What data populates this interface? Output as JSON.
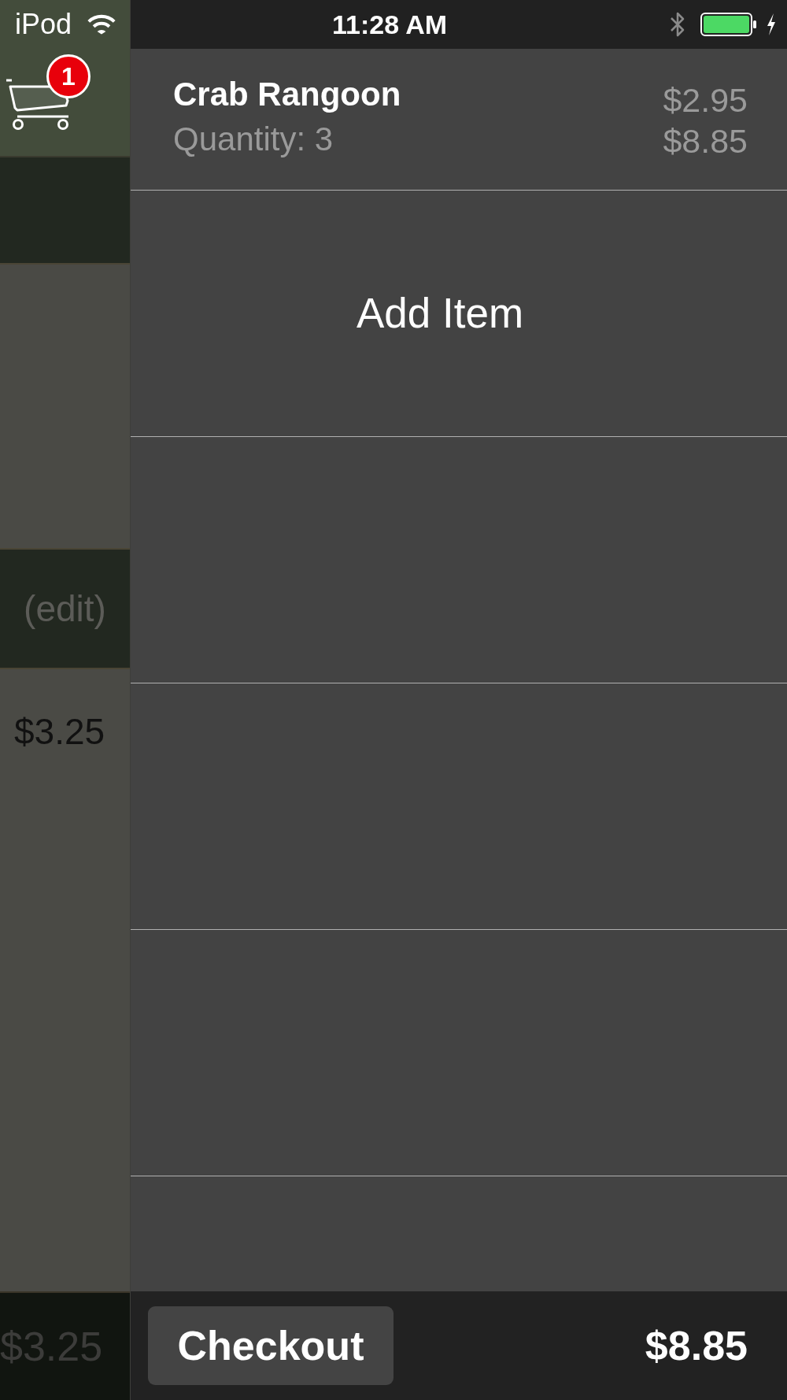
{
  "status_bar": {
    "carrier": "iPod",
    "time": "11:28 AM"
  },
  "side_menu": {
    "cart_badge": "1",
    "edit_label": "(edit)",
    "price": "$3.25",
    "footer_price": "$3.25"
  },
  "order": {
    "items": [
      {
        "name": "Crab Rangoon",
        "quantity": "Quantity: 3",
        "unit_price": "$2.95",
        "line_total": "$8.85"
      }
    ],
    "add_item": "Add Item"
  },
  "footer": {
    "checkout": "Checkout",
    "total": "$8.85"
  }
}
